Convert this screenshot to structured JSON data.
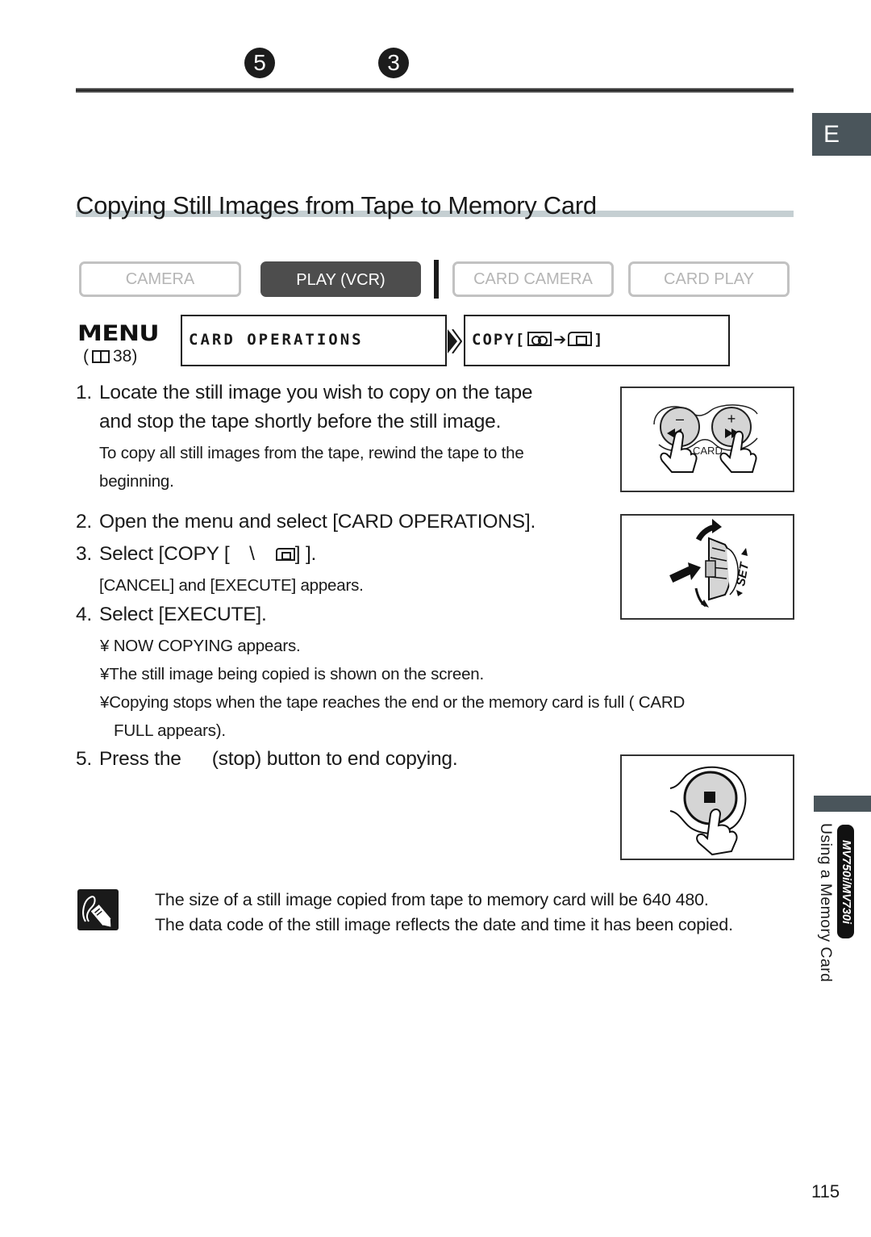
{
  "header": {
    "chapter_number": "5",
    "section_number": "3"
  },
  "language_tab": "E",
  "section_title": "Copying Still Images from Tape to Memory Card",
  "modes": [
    {
      "label": "CAMERA",
      "active": false
    },
    {
      "label": "PLAY (VCR)",
      "active": true
    },
    {
      "label": "CARD CAMERA",
      "active": false
    },
    {
      "label": "CARD PLAY",
      "active": false
    }
  ],
  "menu": {
    "logo": "MENU",
    "ref_open": "(",
    "ref_page": "38)",
    "path": [
      {
        "label": "CARD OPERATIONS"
      },
      {
        "prefix": "COPY[",
        "suffix": "]",
        "from_icon": "cassette-icon",
        "arrow": "➔",
        "to_icon": "memory-card-icon"
      }
    ]
  },
  "steps": [
    {
      "number": "1.",
      "lines": [
        "Locate the still image you wish to copy on the tape",
        "and stop the tape shortly before the still image."
      ],
      "note_lines": [
        "To copy all still images from the tape, rewind the tape to the",
        "beginning."
      ]
    },
    {
      "number": "2.",
      "lines": [
        "Open the menu and select [CARD OPERATIONS]."
      ]
    },
    {
      "number": "3.",
      "prefix": "Select [COPY [",
      "middle": "\\",
      "suffix": "] ].",
      "note_lines": [
        "[CANCEL] and [EXECUTE] appears."
      ]
    },
    {
      "number": "4.",
      "lines": [
        "Select [EXECUTE]."
      ],
      "bullets": [
        {
          "mark": "¥",
          "text": " NOW COPYING  appears."
        },
        {
          "mark": "¥",
          "text": "The still image being copied is shown on the screen."
        },
        {
          "mark": "¥",
          "text": "Copying stops when the tape reaches the end or the memory card is full ( CARD",
          "cont": "FULL  appears)."
        }
      ]
    },
    {
      "number": "5.",
      "prefix": "Press the",
      "suffix": "(stop) button to end copying."
    }
  ],
  "illustrations": {
    "search_buttons": {
      "minus": "–",
      "plus": "+",
      "card_label": "CARD"
    },
    "set_dial": {
      "label": "SET"
    },
    "stop_button": {}
  },
  "note": {
    "lines": [
      "The size of a still image copied from tape to memory card will be 640 480.",
      "The data code of the still image reflects the date and time it has been copied."
    ]
  },
  "side": {
    "model_badge": "MV750i/MV730i",
    "chapter_label": "Using a Memory Card"
  },
  "page_number": "115"
}
